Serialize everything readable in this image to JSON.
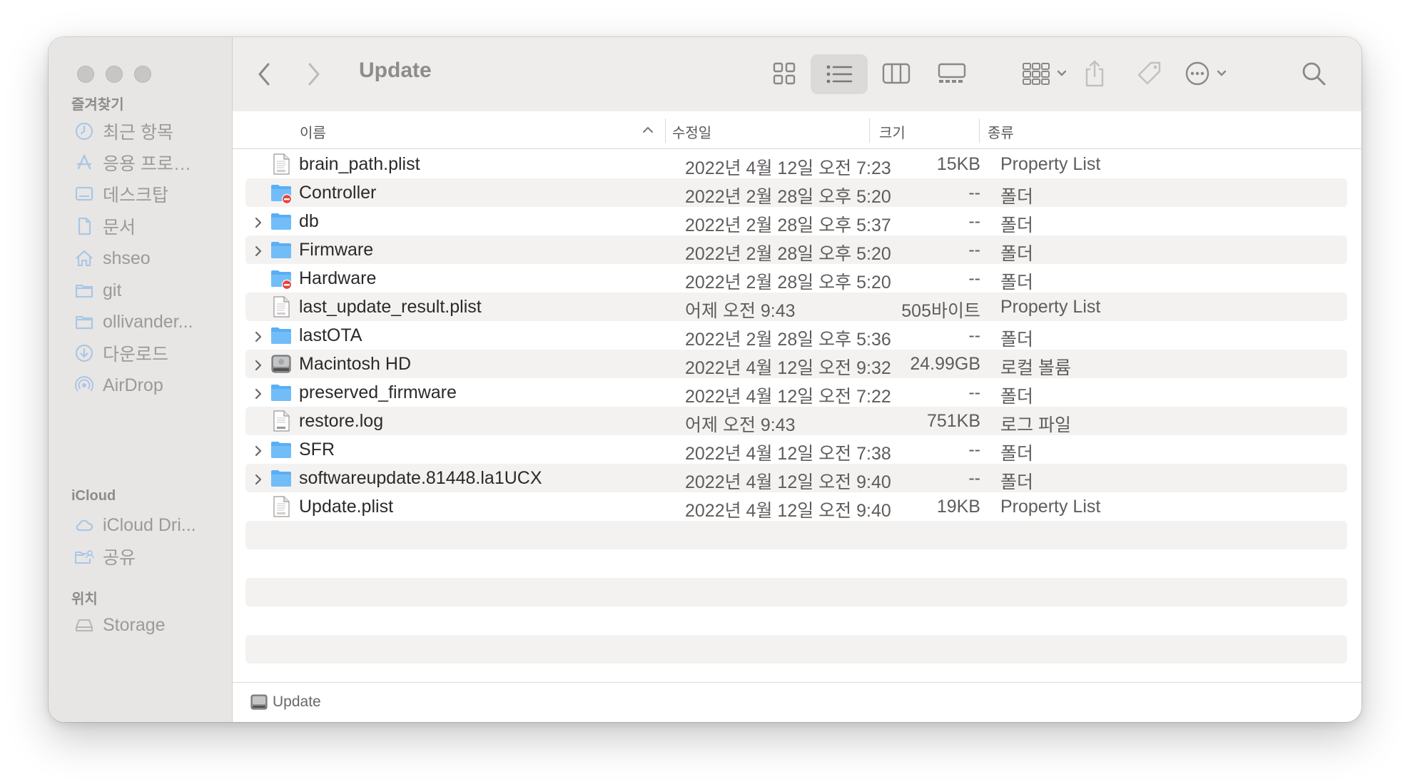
{
  "window": {
    "title": "Update"
  },
  "sidebar": {
    "favorites_header": "즐겨찾기",
    "favorites": [
      {
        "label": "최근 항목",
        "icon": "clock-icon"
      },
      {
        "label": "응용 프로…",
        "icon": "applications-icon"
      },
      {
        "label": "데스크탑",
        "icon": "desktop-icon"
      },
      {
        "label": "문서",
        "icon": "document-icon"
      },
      {
        "label": "shseo",
        "icon": "home-icon"
      },
      {
        "label": "git",
        "icon": "folder-icon"
      },
      {
        "label": "ollivander...",
        "icon": "folder-icon"
      },
      {
        "label": "다운로드",
        "icon": "download-icon"
      },
      {
        "label": "AirDrop",
        "icon": "airdrop-icon"
      }
    ],
    "icloud_header": "iCloud",
    "icloud": [
      {
        "label": "iCloud Dri...",
        "icon": "cloud-icon"
      },
      {
        "label": "공유",
        "icon": "shared-folder-icon"
      }
    ],
    "locations_header": "위치",
    "locations": [
      {
        "label": "Storage",
        "icon": "drive-icon"
      }
    ]
  },
  "columns": {
    "name": "이름",
    "modified": "수정일",
    "size": "크기",
    "kind": "종류"
  },
  "files": [
    {
      "name": "brain_path.plist",
      "date": "2022년 4월 12일 오전 7:23",
      "size": "15KB",
      "kind": "Property List",
      "icon": "plist-file-icon",
      "expandable": false
    },
    {
      "name": "Controller",
      "date": "2022년 2월 28일 오후 5:20",
      "size": "--",
      "kind": "폴더",
      "icon": "restricted-folder-icon",
      "expandable": false
    },
    {
      "name": "db",
      "date": "2022년 2월 28일 오후 5:37",
      "size": "--",
      "kind": "폴더",
      "icon": "folder-icon",
      "expandable": true
    },
    {
      "name": "Firmware",
      "date": "2022년 2월 28일 오후 5:20",
      "size": "--",
      "kind": "폴더",
      "icon": "folder-icon",
      "expandable": true
    },
    {
      "name": "Hardware",
      "date": "2022년 2월 28일 오후 5:20",
      "size": "--",
      "kind": "폴더",
      "icon": "restricted-folder-icon",
      "expandable": false
    },
    {
      "name": "last_update_result.plist",
      "date": "어제 오전 9:43",
      "size": "505바이트",
      "kind": "Property List",
      "icon": "plist-file-icon",
      "expandable": false
    },
    {
      "name": "lastOTA",
      "date": "2022년 2월 28일 오후 5:36",
      "size": "--",
      "kind": "폴더",
      "icon": "folder-icon",
      "expandable": true
    },
    {
      "name": "Macintosh HD",
      "date": "2022년 4월 12일 오전 9:32",
      "size": "24.99GB",
      "kind": "로컬 볼륨",
      "icon": "hard-drive-icon",
      "expandable": true
    },
    {
      "name": "preserved_firmware",
      "date": "2022년 4월 12일 오전 7:22",
      "size": "--",
      "kind": "폴더",
      "icon": "folder-icon",
      "expandable": true
    },
    {
      "name": "restore.log",
      "date": "어제 오전 9:43",
      "size": "751KB",
      "kind": "로그 파일",
      "icon": "log-file-icon",
      "expandable": false
    },
    {
      "name": "SFR",
      "date": "2022년 4월 12일 오전 7:38",
      "size": "--",
      "kind": "폴더",
      "icon": "folder-icon",
      "expandable": true
    },
    {
      "name": "softwareupdate.81448.la1UCX",
      "date": "2022년 4월 12일 오전 9:40",
      "size": "--",
      "kind": "폴더",
      "icon": "folder-icon",
      "expandable": true
    },
    {
      "name": "Update.plist",
      "date": "2022년 4월 12일 오전 9:40",
      "size": "19KB",
      "kind": "Property List",
      "icon": "plist-file-icon",
      "expandable": false
    }
  ],
  "statusbar": {
    "path": "Update",
    "icon": "hard-drive-icon"
  }
}
